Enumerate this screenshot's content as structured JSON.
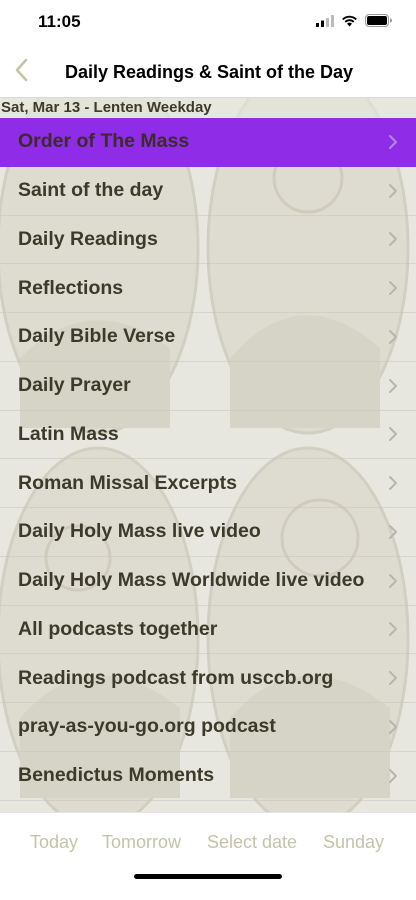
{
  "status_bar": {
    "time": "11:05"
  },
  "nav": {
    "title": "Daily Readings & Saint of the Day"
  },
  "date_banner": "Sat, Mar 13 - Lenten Weekday",
  "menu": {
    "items": [
      {
        "label": "Order of The Mass",
        "selected": true
      },
      {
        "label": "Saint of the day"
      },
      {
        "label": "Daily Readings"
      },
      {
        "label": "Reflections"
      },
      {
        "label": "Daily Bible Verse"
      },
      {
        "label": "Daily Prayer"
      },
      {
        "label": "Latin Mass"
      },
      {
        "label": "Roman Missal Excerpts"
      },
      {
        "label": "Daily Holy Mass live video"
      },
      {
        "label": "Daily Holy Mass Worldwide live video"
      },
      {
        "label": "All podcasts together"
      },
      {
        "label": "Readings podcast from usccb.org"
      },
      {
        "label": "pray-as-you-go.org podcast"
      },
      {
        "label": "Benedictus Moments"
      }
    ]
  },
  "toolbar": {
    "today": "Today",
    "tomorrow": "Tomorrow",
    "select_date": "Select date",
    "sunday": "Sunday"
  },
  "colors": {
    "selected_row": "#8e2ce8",
    "toolbar_text": "#c5c3a9",
    "label_text": "#3c3a2a",
    "back_chevron": "#c7c3a6"
  },
  "icons": {
    "back": "chevron-left-icon",
    "row_disclosure": "chevron-right-icon",
    "signal": "cellular-signal-icon",
    "wifi": "wifi-icon",
    "battery": "battery-icon"
  }
}
